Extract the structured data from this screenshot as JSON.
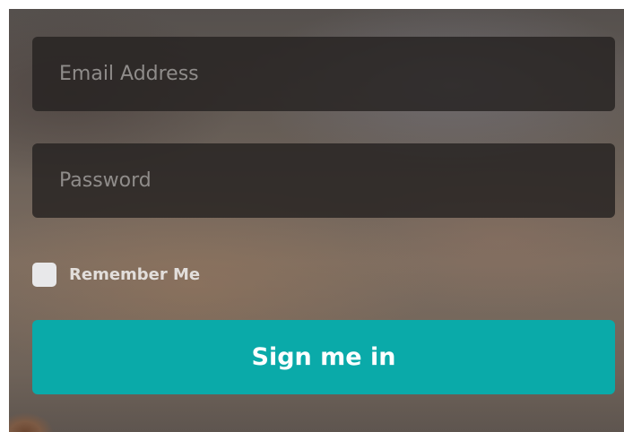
{
  "form": {
    "email": {
      "value": "",
      "placeholder": "Email Address"
    },
    "password": {
      "value": "",
      "placeholder": "Password"
    },
    "remember": {
      "label": "Remember Me",
      "checked": false
    },
    "submit_label": "Sign me in"
  },
  "colors": {
    "button": "#0aaaa9",
    "button_text": "#ffffff",
    "field_background": "#262221",
    "placeholder": "#8f8c8a",
    "checkbox": "#e8e8ea"
  }
}
